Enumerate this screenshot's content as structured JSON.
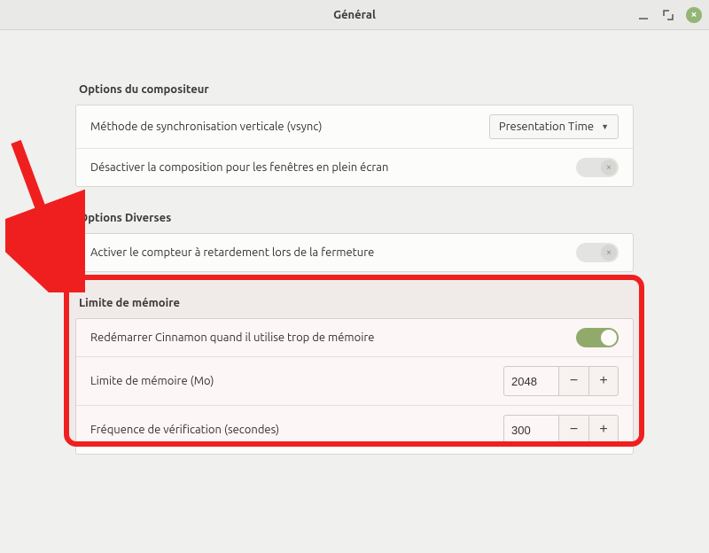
{
  "window": {
    "title": "Général"
  },
  "sections": {
    "compositor": {
      "title": "Options du compositeur",
      "vsync_label": "Méthode de synchronisation verticale (vsync)",
      "vsync_value": "Presentation Time",
      "fullscreen_disable_label": "Désactiver la composition pour les fenêtres en plein écran",
      "fullscreen_disable_on": false
    },
    "misc": {
      "title": "Options Diverses",
      "delay_counter_label": "Activer le compteur à retardement lors de la fermeture",
      "delay_counter_on": false
    },
    "memory": {
      "title": "Limite de mémoire",
      "restart_label": "Redémarrer Cinnamon quand il utilise trop de mémoire",
      "restart_on": true,
      "limit_label": "Limite de mémoire (Mo)",
      "limit_value": "2048",
      "freq_label": "Fréquence de vérification (secondes)",
      "freq_value": "300"
    }
  },
  "annotation": {
    "target": "memory-limit-section"
  }
}
